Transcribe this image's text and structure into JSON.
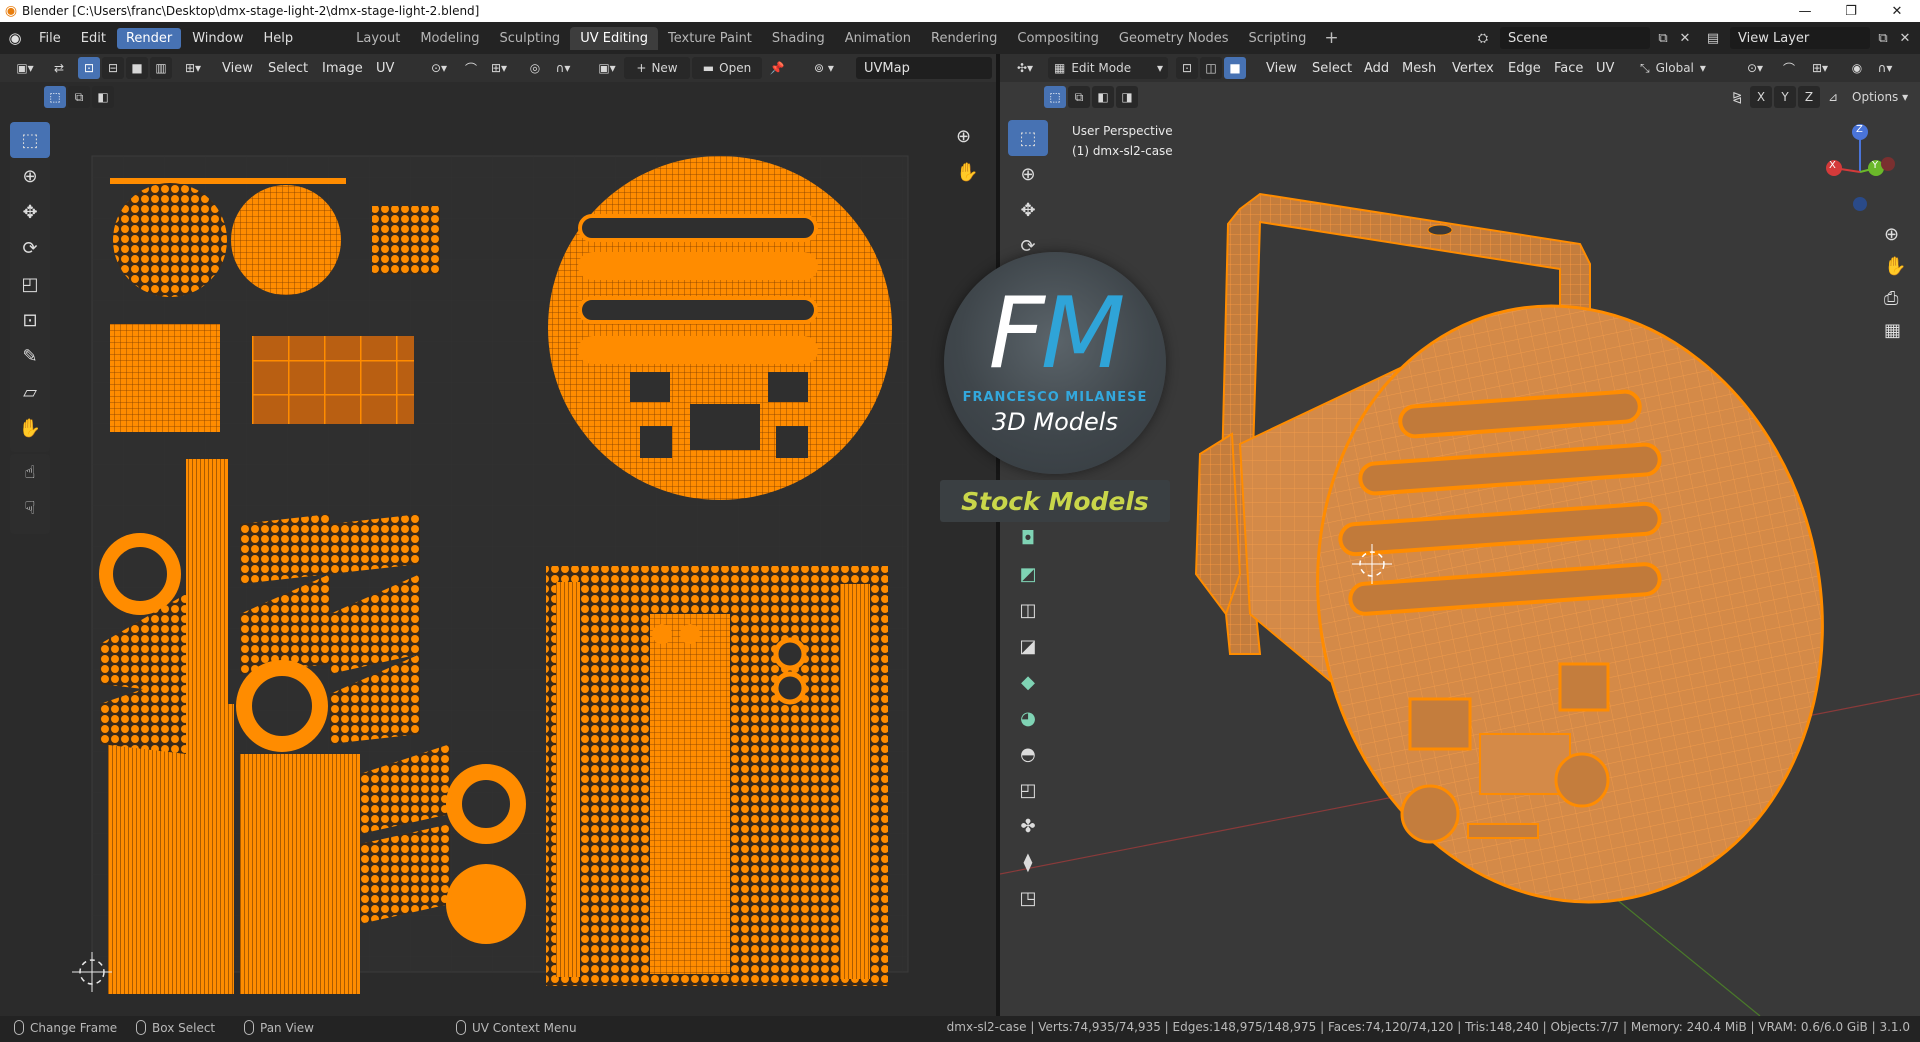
{
  "titlebar": {
    "title": "Blender [C:\\Users\\franc\\Desktop\\dmx-stage-light-2\\dmx-stage-light-2.blend]"
  },
  "menu": [
    "File",
    "Edit",
    "Render",
    "Window",
    "Help"
  ],
  "workspaces": [
    "Layout",
    "Modeling",
    "Sculpting",
    "UV Editing",
    "Texture Paint",
    "Shading",
    "Animation",
    "Rendering",
    "Compositing",
    "Geometry Nodes",
    "Scripting"
  ],
  "active_workspace": "UV Editing",
  "scene": "Scene",
  "view_layer": "View Layer",
  "uv_editor": {
    "menus": [
      "View",
      "Select",
      "Image",
      "UV"
    ],
    "new_label": "New",
    "open_label": "Open",
    "uvmap": "UVMap"
  },
  "viewport": {
    "mode": "Edit Mode",
    "menus": [
      "View",
      "Select",
      "Add",
      "Mesh",
      "Vertex",
      "Edge",
      "Face",
      "UV"
    ],
    "transform_orientation": "Global",
    "options_label": "Options",
    "axes": {
      "x": "X",
      "y": "Y",
      "z": "Z"
    },
    "overlay_title": "User Perspective",
    "overlay_object": "(1) dmx-sl2-case"
  },
  "watermark": {
    "fm_f": "F",
    "fm_m": "M",
    "name": "FRANCESCO MILANESE",
    "subtitle": "3D Models",
    "stock": "Stock Models"
  },
  "statusbar": {
    "change_frame": "Change Frame",
    "box_select": "Box Select",
    "pan_view": "Pan View",
    "context_menu": "UV Context Menu",
    "stats": "dmx-sl2-case | Verts:74,935/74,935 | Edges:148,975/148,975 | Faces:74,120/74,120 | Tris:148,240 | Objects:7/7 | Memory: 240.4 MiB | VRAM: 0.6/6.0 GiB | 3.1.0"
  },
  "colors": {
    "accent": "#4772b3",
    "uv_orange": "#ff8c00",
    "mesh_orange": "#e8882a"
  }
}
